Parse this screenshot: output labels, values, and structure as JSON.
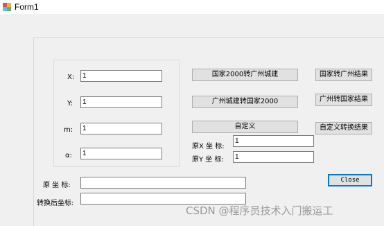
{
  "window": {
    "title": "Form1",
    "icon": "winforms-app-icon"
  },
  "params": {
    "x_label": "X:",
    "x_value": "1",
    "y_label": "Y:",
    "y_value": "1",
    "m_label": "m:",
    "m_value": "1",
    "a_label": "α:",
    "a_value": "1"
  },
  "buttons": {
    "cgcs_to_gz": "国家2000转广州城建",
    "gz_to_cgcs": "广州城建转国家2000",
    "custom": "自定义",
    "result_cgcs_to_gz": "国家转广州结果",
    "result_gz_to_cgcs": "广州转国家结果",
    "result_custom": "自定义转换结果",
    "close": "Close"
  },
  "original_coords": {
    "x_label": "原X 坐 标:",
    "x_value": "1",
    "y_label": "原Y 坐 标:",
    "y_value": "1"
  },
  "bottom": {
    "original_label": "原 坐 标:",
    "original_value": "",
    "converted_label": "转换后坐标:",
    "converted_value": ""
  },
  "watermark": "CSDN @程序员技术入门搬运工"
}
